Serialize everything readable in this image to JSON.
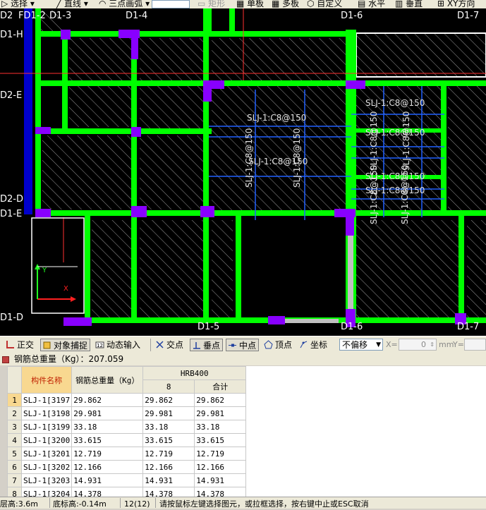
{
  "top_toolbar": {
    "items": [
      "选择",
      "直线",
      "三点画弧",
      "矩形",
      "单板",
      "多板",
      "自定义",
      "水平",
      "垂直",
      "XY方向"
    ]
  },
  "drawing": {
    "axis_labels": [
      "D2",
      "FD1-2",
      "D1-3",
      "D1-4",
      "D1-6",
      "D1-7",
      "D1-H",
      "D2-E",
      "D2-D",
      "D1-E",
      "D1-D",
      "D1-5",
      "D1-6",
      "D1-7"
    ],
    "rebar_labels": [
      "SLJ-1:C8@150",
      "SLJ-1:C8@150",
      "SLJ-1:C8@150",
      "SLJ-1:C8@150",
      "SLJ-1:C8@150",
      "SLJ-1:C8@150",
      "SLJ-1:C8@150",
      "SLJ-1:C8@150",
      "SLJ-1:C8@150",
      "SLJ-1:C8@150",
      "SLJ-1:C8@150",
      "SLJ-1:C8@150"
    ],
    "colors": {
      "beam": "#00ff00",
      "column": "#8800ff",
      "rebar": "#2060ff",
      "wall": "#0000cc",
      "selected_beam": "#c0c0c0",
      "background": "#000000"
    }
  },
  "snap_toolbar": {
    "orthogonal": "正交",
    "object_snap": "对象捕捉",
    "dynamic_input": "动态输入",
    "intersection": "交点",
    "perpendicular": "垂点",
    "midpoint": "中点",
    "vertex": "顶点",
    "coordinate": "坐标",
    "offset_mode": "不偏移",
    "x_label": "X=",
    "x_value": "0",
    "unit": "mm",
    "y_label": "Y="
  },
  "panel": {
    "title": "钢筋总重量（Kg）：207.059"
  },
  "table": {
    "col_name": "构件名称",
    "col_total": "钢筋总重量（Kg）",
    "group": "HRB400",
    "sub_8": "8",
    "sub_total": "合计",
    "rows": [
      {
        "n": "1",
        "name": "SLJ-1[3197",
        "total": "29.862",
        "d8": "29.862",
        "sum": "29.862"
      },
      {
        "n": "2",
        "name": "SLJ-1[3198",
        "total": "29.981",
        "d8": "29.981",
        "sum": "29.981"
      },
      {
        "n": "3",
        "name": "SLJ-1[3199",
        "total": "33.18",
        "d8": "33.18",
        "sum": "33.18"
      },
      {
        "n": "4",
        "name": "SLJ-1[3200",
        "total": "33.615",
        "d8": "33.615",
        "sum": "33.615"
      },
      {
        "n": "5",
        "name": "SLJ-1[3201",
        "total": "12.719",
        "d8": "12.719",
        "sum": "12.719"
      },
      {
        "n": "6",
        "name": "SLJ-1[3202",
        "total": "12.166",
        "d8": "12.166",
        "sum": "12.166"
      },
      {
        "n": "7",
        "name": "SLJ-1[3203",
        "total": "14.931",
        "d8": "14.931",
        "sum": "14.931"
      },
      {
        "n": "8",
        "name": "SLJ-1[3204",
        "total": "14.378",
        "d8": "14.378",
        "sum": "14.378"
      }
    ]
  },
  "status": {
    "floor_height": "层高:3.6m",
    "bottom_elev": "底标高:-0.14m",
    "count": "12(12)",
    "prompt": "请按鼠标左键选择图元，或拉框选择，按右键中止或ESC取消"
  }
}
